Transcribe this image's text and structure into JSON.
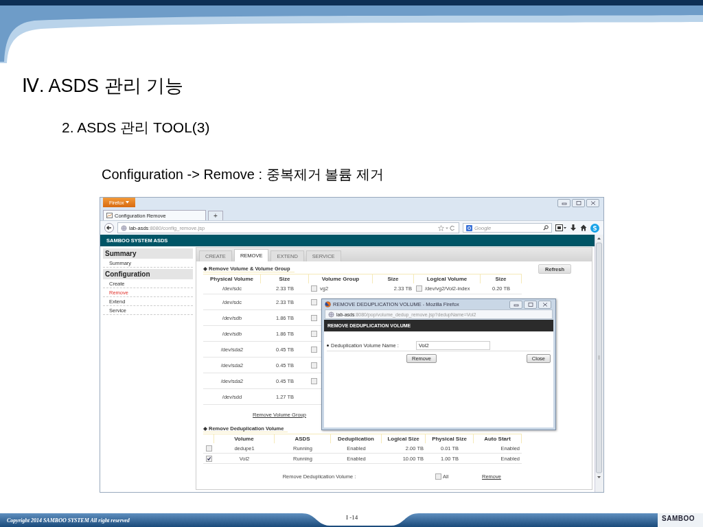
{
  "slide": {
    "title": "Ⅳ. ASDS 관리 기능",
    "subtitle": "2. ASDS 관리 TOOL(3)",
    "caption": "Configuration -> Remove : 중복제거 볼륨 제거"
  },
  "browser": {
    "menu_button": "Firefox",
    "tab_title": "Configuration Remove",
    "new_tab": "+",
    "url_host": "lab-asds",
    "url_rest": ":8080/config_remove.jsp",
    "search_placeholder": "Google"
  },
  "app": {
    "header": "SAMBOO SYSTEM ASDS",
    "sidebar": [
      {
        "title": "Summary",
        "items": [
          {
            "label": "Summary",
            "selected": false
          }
        ]
      },
      {
        "title": "Configuration",
        "items": [
          {
            "label": "Create",
            "selected": false
          },
          {
            "label": "Remove",
            "selected": true
          },
          {
            "label": "Extend",
            "selected": false
          },
          {
            "label": "Service",
            "selected": false
          }
        ]
      }
    ],
    "tabs": [
      {
        "label": "CREATE",
        "selected": false
      },
      {
        "label": "REMOVE",
        "selected": true
      },
      {
        "label": "EXTEND",
        "selected": false
      },
      {
        "label": "SERVICE",
        "selected": false
      }
    ],
    "refresh_button": "Refresh",
    "volume_section": {
      "title": "Remove Volume & Volume Group",
      "columns": [
        "Physical Volume",
        "Size",
        "Volume Group",
        "Size",
        "Logical Volume",
        "Size"
      ],
      "rows": [
        {
          "physical_volume": "/dev/sdc",
          "size": "2.33 TB",
          "volume_group": {
            "checked": false,
            "name": "vg2",
            "size": "2.33 TB"
          },
          "logical_volume": {
            "checked": false,
            "name": "/dev/vg2/Vol2-index",
            "size": "0.20 TB"
          }
        },
        {
          "physical_volume": "/dev/sdc",
          "size": "2.33 TB",
          "volume_group": {
            "checked": false
          }
        },
        {
          "physical_volume": "/dev/sdb",
          "size": "1.86 TB",
          "volume_group": {
            "checked": false
          }
        },
        {
          "physical_volume": "/dev/sdb",
          "size": "1.86 TB",
          "volume_group": {
            "checked": false
          }
        },
        {
          "physical_volume": "/dev/sda2",
          "size": "0.45 TB",
          "volume_group": {
            "checked": false
          }
        },
        {
          "physical_volume": "/dev/sda2",
          "size": "0.45 TB",
          "volume_group": {
            "checked": false
          }
        },
        {
          "physical_volume": "/dev/sda2",
          "size": "0.45 TB",
          "volume_group": {
            "checked": false
          }
        },
        {
          "physical_volume": "/dev/sdd",
          "size": "1.27 TB"
        }
      ],
      "link": "Remove Volume Group"
    },
    "dedup_section": {
      "title": "Remove Deduplication Volume",
      "columns": [
        "Volume",
        "ASDS",
        "Deduplication",
        "Logical Size",
        "Physical Size",
        "Auto Start"
      ],
      "rows": [
        {
          "checked": false,
          "volume": "dedupe1",
          "asds": "Running",
          "deduplication": "Enabled",
          "logical_size": "2.00 TB",
          "physical_size": "0.01 TB",
          "auto_start": "Enabled"
        },
        {
          "checked": true,
          "volume": "Vol2",
          "asds": "Running",
          "deduplication": "Enabled",
          "logical_size": "10.00 TB",
          "physical_size": "1.00 TB",
          "auto_start": "Enabled"
        }
      ],
      "footer_label": "Remove Deduplication Volume :",
      "all": {
        "label": "All",
        "checked": false
      },
      "link": "Remove"
    }
  },
  "popup": {
    "title": "REMOVE DEDUPLICATION VOLUME - Mozilla Firefox",
    "url_host": "lab-asds",
    "url_rest": ":8080/pop/volume_dedup_remove.jsp?dedupName=Vol2",
    "header": "REMOVE DEDUPLICATION VOLUME",
    "field_label": "Deduplication Volume Name :",
    "field_value": "Vol2",
    "buttons": [
      "Remove",
      "Close"
    ]
  },
  "footer": {
    "copyright": "Copyright 2014 SAMBOO SYSTEM All right reserved",
    "page": "I -14",
    "logo": "SAMBOO"
  }
}
